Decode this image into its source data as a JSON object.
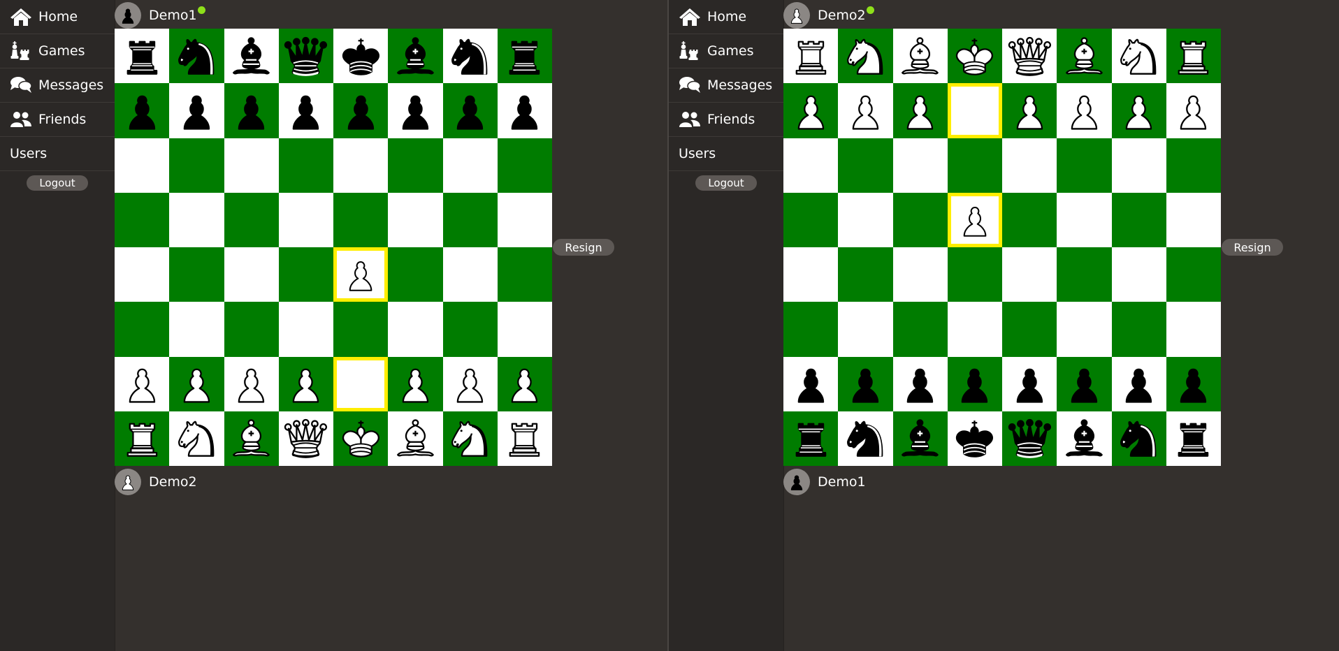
{
  "panes": [
    {
      "nav": {
        "items": [
          {
            "label": "Home",
            "icon": "home-icon"
          },
          {
            "label": "Games",
            "icon": "chess-pieces-icon"
          },
          {
            "label": "Messages",
            "icon": "chat-bubbles-icon"
          },
          {
            "label": "Friends",
            "icon": "friends-icon"
          },
          {
            "label": "Users",
            "icon": ""
          }
        ],
        "logout_label": "Logout"
      },
      "top_player": {
        "name": "Demo1",
        "online": true,
        "avatar_color": "black"
      },
      "bottom_player": {
        "name": "Demo2",
        "online": false,
        "avatar_color": "white"
      },
      "resign_label": "Resign",
      "board": {
        "orientation": "white-bottom",
        "rows": [
          [
            "bR",
            "bN",
            "bB",
            "bQ",
            "bK",
            "bB",
            "bN",
            "bR"
          ],
          [
            "bP",
            "bP",
            "bP",
            "bP",
            "bP",
            "bP",
            "bP",
            "bP"
          ],
          [
            "",
            "",
            "",
            "",
            "",
            "",
            "",
            ""
          ],
          [
            "",
            "",
            "",
            "",
            "",
            "",
            "",
            ""
          ],
          [
            "",
            "",
            "",
            "",
            "wP",
            "",
            "",
            ""
          ],
          [
            "",
            "",
            "",
            "",
            "",
            "",
            "",
            ""
          ],
          [
            "wP",
            "wP",
            "wP",
            "wP",
            "",
            "wP",
            "wP",
            "wP"
          ],
          [
            "wR",
            "wN",
            "wB",
            "wQ",
            "wK",
            "wB",
            "wN",
            "wR"
          ]
        ],
        "highlights": [
          [
            4,
            4
          ],
          [
            6,
            4
          ]
        ]
      }
    },
    {
      "nav": {
        "items": [
          {
            "label": "Home",
            "icon": "home-icon"
          },
          {
            "label": "Games",
            "icon": "chess-pieces-icon"
          },
          {
            "label": "Messages",
            "icon": "chat-bubbles-icon"
          },
          {
            "label": "Friends",
            "icon": "friends-icon"
          },
          {
            "label": "Users",
            "icon": ""
          }
        ],
        "logout_label": "Logout"
      },
      "top_player": {
        "name": "Demo2",
        "online": true,
        "avatar_color": "white"
      },
      "bottom_player": {
        "name": "Demo1",
        "online": false,
        "avatar_color": "black"
      },
      "resign_label": "Resign",
      "board": {
        "orientation": "black-bottom",
        "rows": [
          [
            "wR",
            "wN",
            "wB",
            "wK",
            "wQ",
            "wB",
            "wN",
            "wR"
          ],
          [
            "wP",
            "wP",
            "wP",
            "",
            "wP",
            "wP",
            "wP",
            "wP"
          ],
          [
            "",
            "",
            "",
            "",
            "",
            "",
            "",
            ""
          ],
          [
            "",
            "",
            "",
            "wP",
            "",
            "",
            "",
            ""
          ],
          [
            "",
            "",
            "",
            "",
            "",
            "",
            "",
            ""
          ],
          [
            "",
            "",
            "",
            "",
            "",
            "",
            "",
            ""
          ],
          [
            "bP",
            "bP",
            "bP",
            "bP",
            "bP",
            "bP",
            "bP",
            "bP"
          ],
          [
            "bR",
            "bN",
            "bB",
            "bK",
            "bQ",
            "bB",
            "bN",
            "bR"
          ]
        ],
        "highlights": [
          [
            1,
            3
          ],
          [
            3,
            3
          ]
        ]
      }
    }
  ],
  "colors": {
    "light_square": "#ffffff",
    "dark_square": "#007c00",
    "highlight": "#ffee00",
    "online_dot": "#8ee01a",
    "background": "#34302d"
  }
}
